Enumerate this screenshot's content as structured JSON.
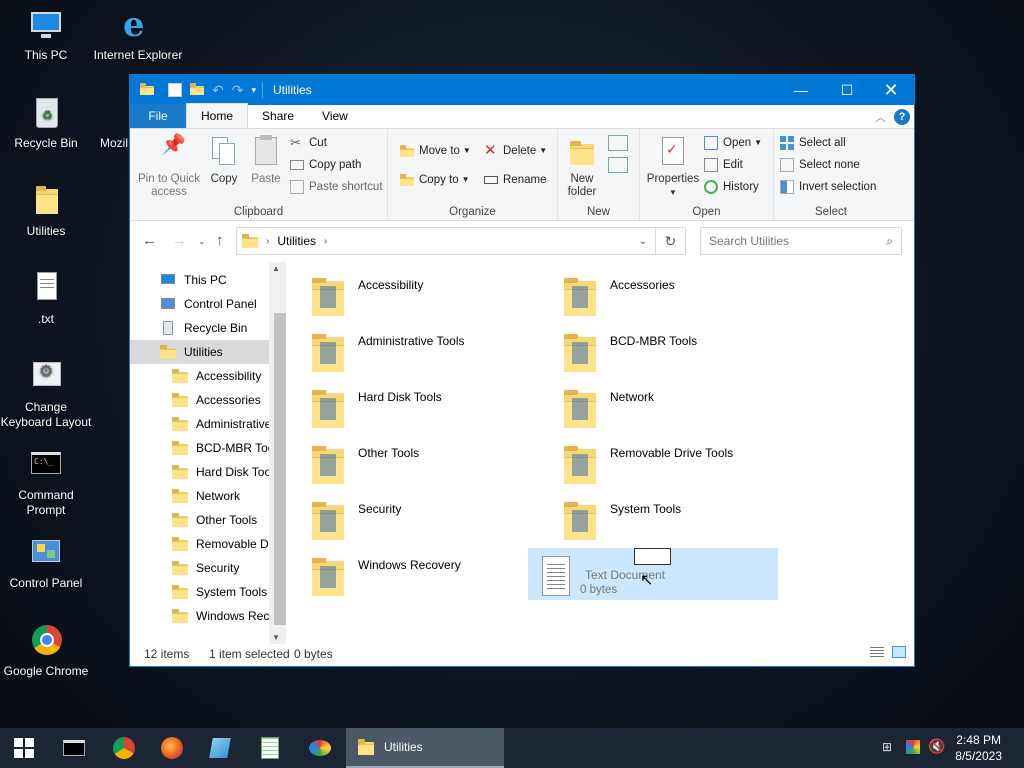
{
  "desktop": {
    "icons": [
      {
        "label": "This PC"
      },
      {
        "label": "Internet Explorer"
      },
      {
        "label": "Recycle Bin"
      },
      {
        "label": "Mozil"
      },
      {
        "label": "Utilities"
      },
      {
        "label": ".txt"
      },
      {
        "label": "Change Keyboard Layout"
      },
      {
        "label": "Command Prompt"
      },
      {
        "label": "Control Panel"
      },
      {
        "label": "Google Chrome"
      }
    ]
  },
  "window": {
    "title": "Utilities",
    "menu": {
      "file": "File",
      "home": "Home",
      "share": "Share",
      "view": "View"
    },
    "ribbon": {
      "clipboard": {
        "label": "Clipboard",
        "pin": "Pin to Quick access",
        "copy": "Copy",
        "paste": "Paste",
        "cut": "Cut",
        "copy_path": "Copy path",
        "paste_shortcut": "Paste shortcut"
      },
      "organize": {
        "label": "Organize",
        "move_to": "Move to",
        "copy_to": "Copy to",
        "delete": "Delete",
        "rename": "Rename"
      },
      "new": {
        "label": "New",
        "new_folder": "New folder"
      },
      "open": {
        "label": "Open",
        "properties": "Properties",
        "open": "Open",
        "edit": "Edit",
        "history": "History"
      },
      "select": {
        "label": "Select",
        "select_all": "Select all",
        "select_none": "Select none",
        "invert": "Invert selection"
      }
    },
    "address": {
      "crumb": "Utilities"
    },
    "search": {
      "placeholder": "Search Utilities"
    },
    "tree": [
      {
        "label": "This PC",
        "level": 0,
        "icon": "pc-icon"
      },
      {
        "label": "Control Panel",
        "level": 0,
        "icon": "control-panel-icon"
      },
      {
        "label": "Recycle Bin",
        "level": 0,
        "icon": "recycle-bin-icon"
      },
      {
        "label": "Utilities",
        "level": 0,
        "icon": "folder-icon",
        "selected": true
      },
      {
        "label": "Accessibility",
        "level": 1,
        "icon": "folder-icon"
      },
      {
        "label": "Accessories",
        "level": 1,
        "icon": "folder-icon"
      },
      {
        "label": "Administrative",
        "level": 1,
        "icon": "folder-icon"
      },
      {
        "label": "BCD-MBR Tool",
        "level": 1,
        "icon": "folder-icon"
      },
      {
        "label": "Hard Disk Tools",
        "level": 1,
        "icon": "folder-icon"
      },
      {
        "label": "Network",
        "level": 1,
        "icon": "folder-icon"
      },
      {
        "label": "Other Tools",
        "level": 1,
        "icon": "folder-icon"
      },
      {
        "label": "Removable Dri",
        "level": 1,
        "icon": "folder-icon"
      },
      {
        "label": "Security",
        "level": 1,
        "icon": "folder-icon"
      },
      {
        "label": "System Tools",
        "level": 1,
        "icon": "folder-icon"
      },
      {
        "label": "Windows Reco",
        "level": 1,
        "icon": "folder-icon"
      }
    ],
    "files": [
      {
        "name": "Accessibility",
        "type": "folder"
      },
      {
        "name": "Accessories",
        "type": "folder"
      },
      {
        "name": "Administrative Tools",
        "type": "folder"
      },
      {
        "name": "BCD-MBR Tools",
        "type": "folder"
      },
      {
        "name": "Hard Disk Tools",
        "type": "folder"
      },
      {
        "name": "Network",
        "type": "folder"
      },
      {
        "name": "Other Tools",
        "type": "folder"
      },
      {
        "name": "Removable Drive Tools",
        "type": "folder"
      },
      {
        "name": "Security",
        "type": "folder"
      },
      {
        "name": "System Tools",
        "type": "folder"
      },
      {
        "name": "Windows Recovery",
        "type": "folder"
      },
      {
        "name": "Text Document",
        "type": "text",
        "size": "0 bytes",
        "selected": true
      }
    ],
    "status": {
      "count": "12 items",
      "selection": "1 item selected",
      "size": "0 bytes"
    }
  },
  "taskbar": {
    "window_button": "Utilities",
    "time": "2:48 PM",
    "date": "8/5/2023",
    "icons": [
      "start-icon",
      "cmd-icon",
      "chrome-icon",
      "firefox-icon",
      "notepad-icon",
      "notepad-plus-icon",
      "paint-icon"
    ]
  },
  "colors": {
    "accent": "#0078d7",
    "selection": "#cce8ff",
    "folder": "#f8d775"
  }
}
